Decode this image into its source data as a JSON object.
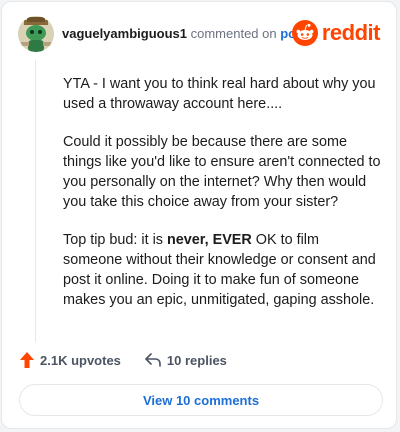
{
  "header": {
    "username": "vaguelyambiguous1",
    "commented_on": "commented on",
    "post_link": "post",
    "brand": "reddit",
    "avatar_icon": "snoo-avatar-icon",
    "logo_icon": "reddit-snoo-icon"
  },
  "comment": {
    "p1": "YTA - I want you to think real hard about why you used a throwaway account here....",
    "p2": "Could it possibly be because there are some things like you'd like to ensure aren't connected to you personally on the internet? Why then would you take this choice away from your sister?",
    "p3_before": "Top tip bud: it is ",
    "p3_bold": "never, EVER",
    "p3_after": " OK to film someone without their knowledge or consent and post it online. Doing it to make fun of someone makes you an epic, unmitigated, gaping asshole."
  },
  "actions": {
    "upvotes": "2.1K upvotes",
    "replies": "10 replies",
    "upvote_icon": "upvote-arrow-icon",
    "reply_icon": "reply-arrow-icon"
  },
  "view_comments_label": "View 10 comments",
  "colors": {
    "accent_blue": "#1d6fd8",
    "reddit_orange": "#ff4500",
    "upvote_orange": "#ff4500"
  }
}
